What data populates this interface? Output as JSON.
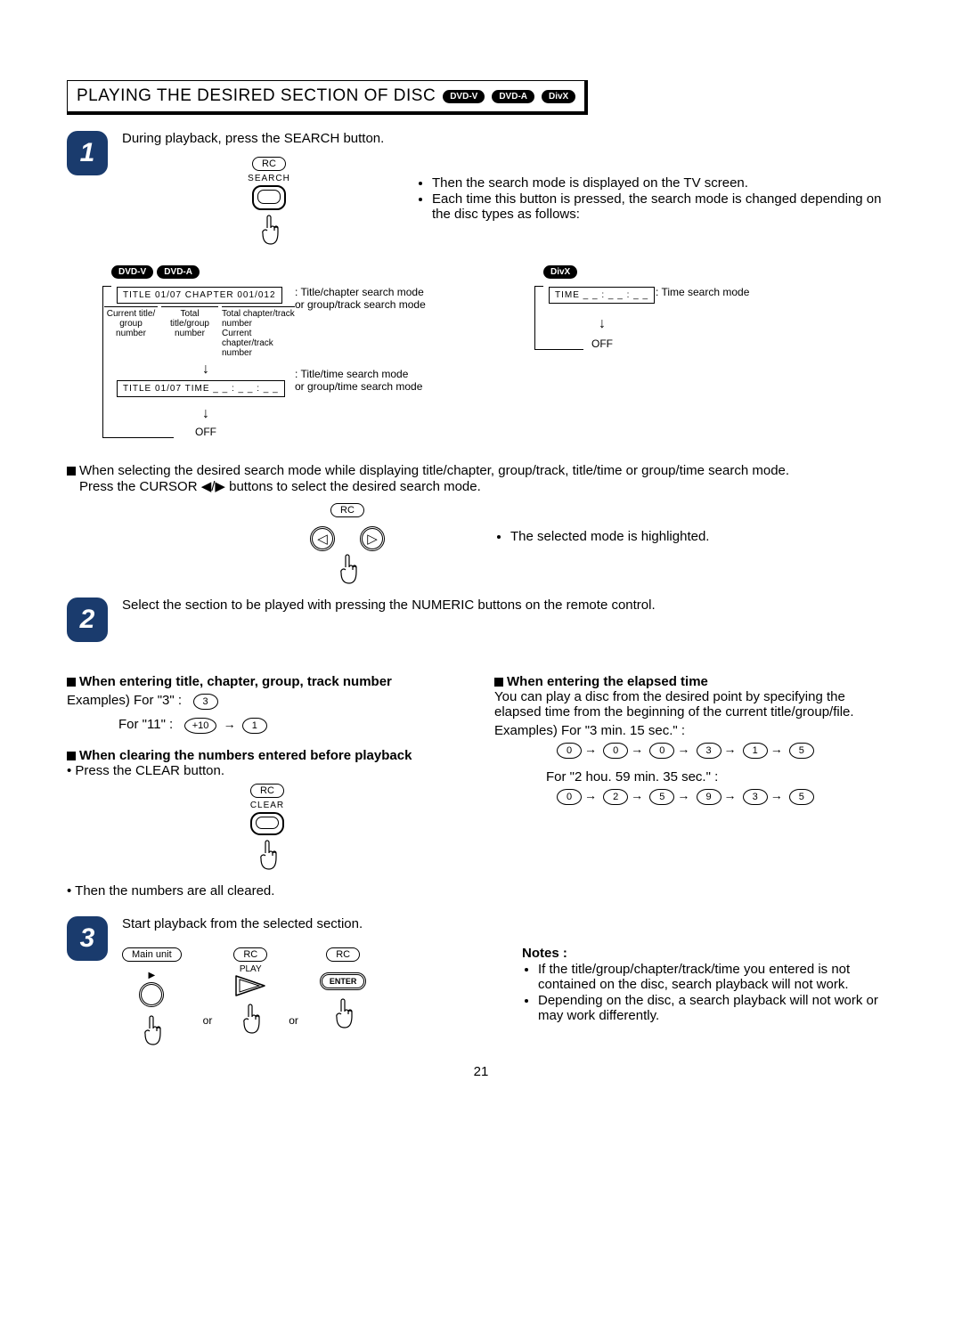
{
  "header": {
    "title": "PLAYING THE DESIRED SECTION OF DISC",
    "badges": [
      "DVD-V",
      "DVD-A",
      "DivX"
    ]
  },
  "step1": {
    "text": "During playback, press the SEARCH button.",
    "rc": "RC",
    "search_label": "SEARCH",
    "right_bul1": "Then the search mode is displayed on the TV screen.",
    "right_bul2": "Each time this button is pressed, the search mode is changed depending on the disc types as follows:",
    "left_badges": [
      "DVD-V",
      "DVD-A"
    ],
    "right_badge": "DivX",
    "osd1": "TITLE  01/07  CHAPTER  001/012",
    "osd1_desc1": ": Title/chapter search mode",
    "osd1_desc2": "or group/track search mode",
    "osd1_l_lab1": "Current title/ group number",
    "osd1_l_lab2": "Total title/group number",
    "osd1_r_lab1": "Total chapter/track number",
    "osd1_r_lab2": "Current chapter/track number",
    "osd2": "TITLE  01/07  TIME  _ _ : _ _ : _ _",
    "osd2_desc1": ": Title/time search mode",
    "osd2_desc2": "or group/time search mode",
    "off": "OFF",
    "osd3": "TIME  _ _ : _ _ : _ _",
    "osd3_desc": ": Time search mode"
  },
  "mid": {
    "line1": "When selecting the desired search mode while displaying title/chapter, group/track, title/time or group/time search mode.",
    "line2_pre": "Press the CURSOR ",
    "line2_post": " buttons to select the desired search mode.",
    "rc": "RC",
    "right": "The selected mode is highlighted."
  },
  "step2": {
    "text": "Select the section to be played with pressing the NUMERIC buttons on the remote control.",
    "hA": "When entering title, chapter, group, track number",
    "exA1_pre": "Examples) For \"3\" :",
    "exA1_btn": "3",
    "exA2_pre": "For \"11\" :",
    "exA2_b1": "+10",
    "exA2_b2": "1",
    "hB": "When clearing the numbers entered before playback",
    "hB_line": "Press the CLEAR button.",
    "rc": "RC",
    "clear_label": "CLEAR",
    "hB_after": "Then the numbers are all cleared.",
    "hR": "When entering the elapsed time",
    "hR_line": "You can play a disc from the desired point by specifying the elapsed time from the beginning of the current title/group/file.",
    "exR1_pre": "Examples) For \"3 min. 15 sec.\" :",
    "exR1_seq": [
      "0",
      "0",
      "0",
      "3",
      "1",
      "5"
    ],
    "exR2_pre": "For \"2 hou. 59 min. 35 sec.\" :",
    "exR2_seq": [
      "0",
      "2",
      "5",
      "9",
      "3",
      "5"
    ]
  },
  "step3": {
    "text": "Start playback from the selected section.",
    "mu": "Main unit",
    "rc": "RC",
    "play_label": "PLAY",
    "enter": "ENTER",
    "or": "or",
    "notes_h": "Notes :",
    "note1": "If the title/group/chapter/track/time you entered is not contained on the disc, search playback will not work.",
    "note2": "Depending on the disc, a search playback will not work or may work differently."
  },
  "page_number": "21"
}
